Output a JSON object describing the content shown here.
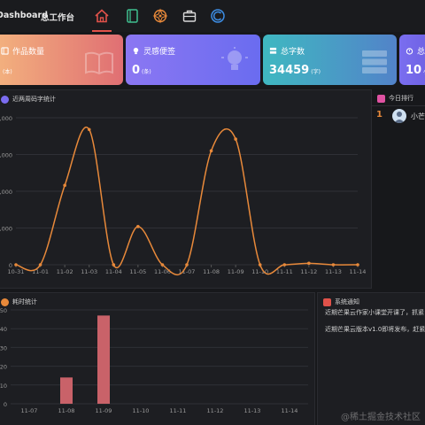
{
  "header": {
    "tabs": [
      {
        "label": "Dashboard"
      },
      {
        "label": "总工作台"
      }
    ],
    "nav_icons": [
      "home-icon",
      "notebook-icon",
      "compass-icon",
      "briefcase-icon",
      "ring-icon"
    ]
  },
  "cards": [
    {
      "title": "作品数量",
      "value": "",
      "unit": "(本)",
      "icon": "book-icon",
      "color_from": "#f3b27e",
      "color_to": "#e06f73"
    },
    {
      "title": "灵感便签",
      "value": "0",
      "unit": "(条)",
      "icon": "bulb-icon",
      "color_from": "#8b77f2",
      "color_to": "#6a6cf0"
    },
    {
      "title": "总字数",
      "value": "34459",
      "unit": "(字)",
      "icon": "database-icon",
      "color_from": "#3fb8c1",
      "color_to": "#5283c9"
    },
    {
      "title": "总",
      "value": "10",
      "unit": "小",
      "icon": "alarm-icon",
      "color_from": "#7a6ef0",
      "color_to": "#6c5fe0"
    }
  ],
  "word_chart": {
    "title": "近两周码字统计",
    "color": "#e8893a"
  },
  "ranking": {
    "title": "今日排行",
    "items": [
      {
        "rank": "1",
        "name": "小芒"
      }
    ]
  },
  "time_chart": {
    "title": "耗时统计",
    "color": "#c96269"
  },
  "notices": {
    "title": "系统通知",
    "items": [
      "近期芒果云作家小课堂开课了，抓紧",
      "近期芒果云版本v1.0即将发布，赶紧"
    ]
  },
  "watermark": "@稀土掘金技术社区",
  "chart_data": [
    {
      "type": "line",
      "title": "近两周码字统计",
      "x": [
        "10-31",
        "11-01",
        "11-02",
        "11-03",
        "11-04",
        "11-05",
        "11-06",
        "11-07",
        "11-08",
        "11-09",
        "11-10",
        "11-11",
        "11-12",
        "11-13",
        "11-14"
      ],
      "y_ticks": [
        "0",
        "5,000",
        "10,000",
        "15,000",
        "20,000"
      ],
      "ylim": [
        0,
        20000
      ],
      "series": [
        {
          "values": [
            0,
            0,
            10800,
            18400,
            0,
            5200,
            0,
            0,
            15500,
            17100,
            0,
            0,
            200,
            0,
            0
          ]
        }
      ],
      "grid": "horizontal"
    },
    {
      "type": "bar",
      "title": "耗时统计",
      "categories": [
        "11-07",
        "11-08",
        "11-09",
        "11-10",
        "11-11",
        "11-12",
        "11-13",
        "11-14"
      ],
      "y_ticks": [
        "0",
        "10",
        "20",
        "30",
        "40",
        "50"
      ],
      "ylim": [
        0,
        50
      ],
      "values": [
        0,
        14,
        47,
        0,
        0,
        0,
        0,
        0
      ],
      "grid": "horizontal"
    }
  ]
}
